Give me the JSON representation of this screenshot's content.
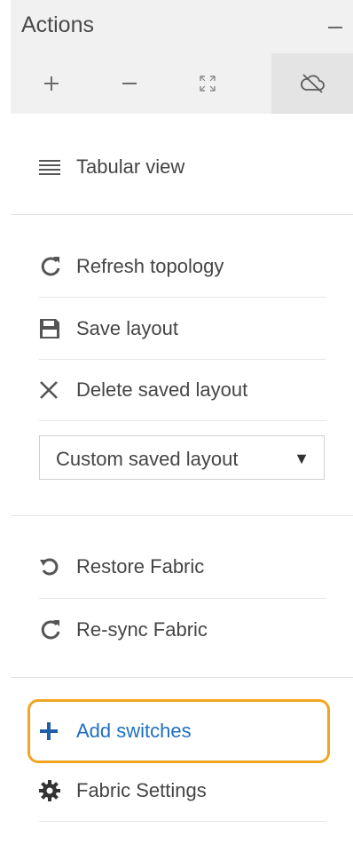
{
  "panel": {
    "title": "Actions"
  },
  "toolbar": {
    "buttons": [
      {
        "icon": "plus-icon",
        "label": "+"
      },
      {
        "icon": "minus-icon",
        "label": "−"
      },
      {
        "icon": "fit-screen-icon",
        "label": ""
      },
      {
        "icon": "cloud-off-icon",
        "label": ""
      }
    ]
  },
  "view": {
    "tabular_label": "Tabular view"
  },
  "layout": {
    "refresh_label": "Refresh topology",
    "save_label": "Save layout",
    "delete_label": "Delete saved layout",
    "custom_select_value": "Custom saved layout",
    "caret": "▼"
  },
  "fabric": {
    "restore_label": "Restore Fabric",
    "resync_label": "Re-sync Fabric"
  },
  "switches": {
    "add_label": "Add switches",
    "settings_label": "Fabric Settings"
  },
  "colors": {
    "highlight": "#f0a523",
    "link_blue": "#1f6fbf",
    "header_bg": "#f1f1f1"
  }
}
